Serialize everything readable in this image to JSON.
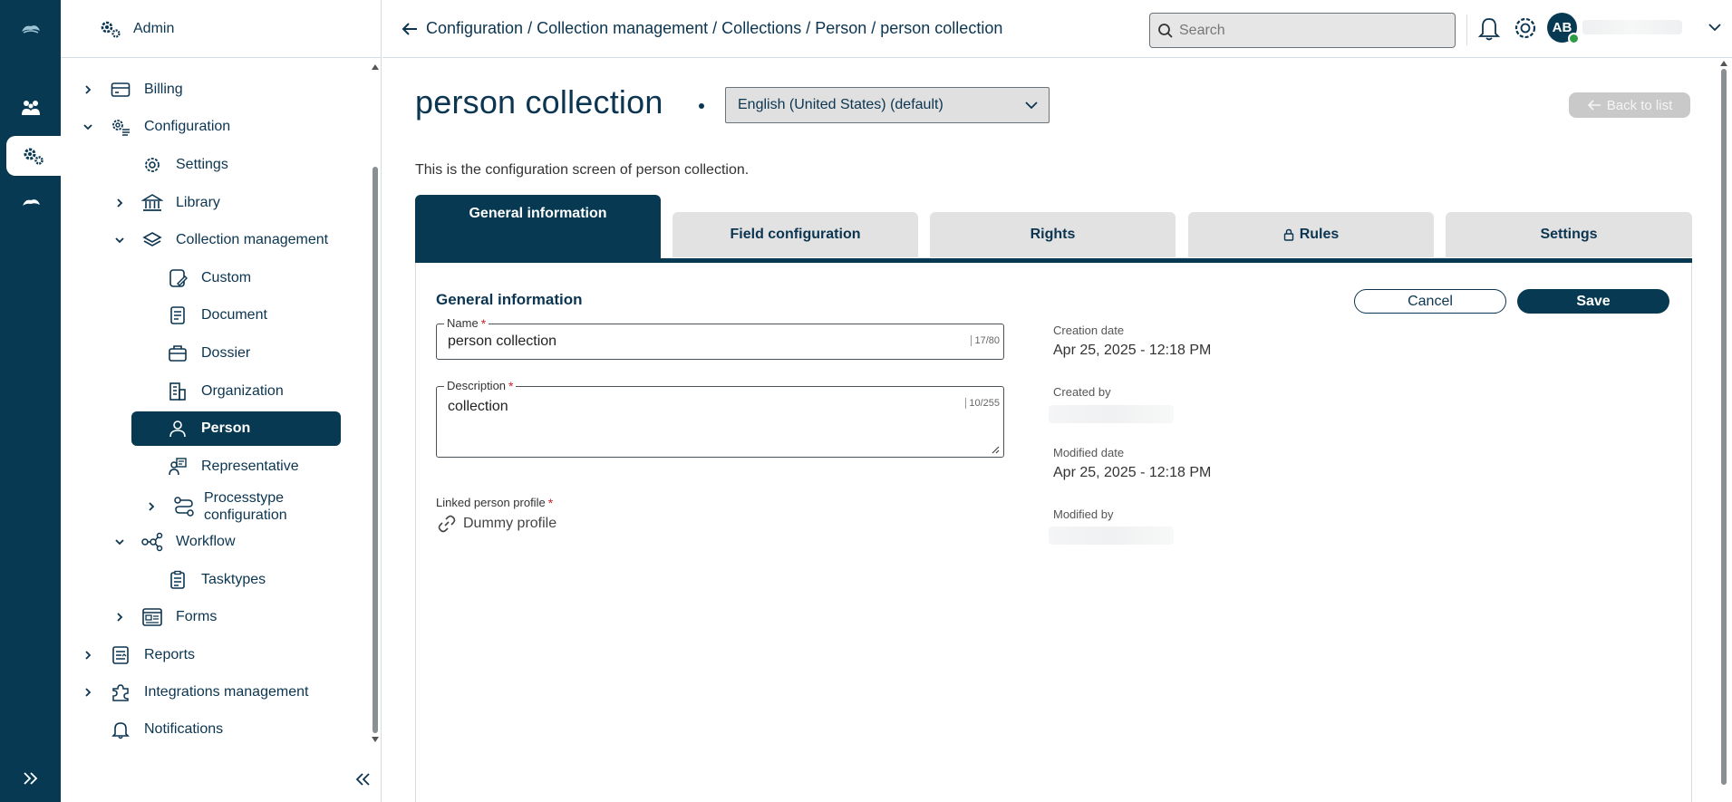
{
  "sidebar": {
    "header": "Admin",
    "items": [
      {
        "label": "Billing",
        "chev": "right",
        "icon": "card-icon"
      },
      {
        "label": "Configuration",
        "chev": "down",
        "icon": "config-gear-icon"
      },
      {
        "label": "Settings",
        "icon": "gear-icon"
      },
      {
        "label": "Library",
        "chev": "right",
        "icon": "library-icon"
      },
      {
        "label": "Collection management",
        "chev": "down",
        "icon": "layers-icon"
      },
      {
        "label": "Custom",
        "icon": "custom-icon"
      },
      {
        "label": "Document",
        "icon": "document-icon"
      },
      {
        "label": "Dossier",
        "icon": "dossier-icon"
      },
      {
        "label": "Organization",
        "icon": "organization-icon"
      },
      {
        "label": "Person",
        "icon": "person-icon",
        "active": true
      },
      {
        "label": "Representative",
        "icon": "representative-icon"
      },
      {
        "label": "Processtype",
        "label2": "configuration",
        "chev": "right",
        "icon": "process-icon"
      },
      {
        "label": "Workflow",
        "chev": "down",
        "icon": "workflow-icon"
      },
      {
        "label": "Tasktypes",
        "icon": "tasktypes-icon"
      },
      {
        "label": "Forms",
        "chev": "right",
        "icon": "forms-icon"
      },
      {
        "label": "Reports",
        "chev": "right",
        "icon": "reports-icon"
      },
      {
        "label": "Integrations management",
        "chev": "right",
        "icon": "puzzle-icon"
      },
      {
        "label": "Notifications",
        "icon": "bell-icon"
      }
    ]
  },
  "header": {
    "breadcrumb": "Configuration / Collection management / Collections / Person / person collection",
    "search_placeholder": "Search",
    "avatar_initials": "AB"
  },
  "main": {
    "title": "person collection",
    "language": "English (United States) (default)",
    "back_to_list": "Back to list",
    "subtitle": "This is the configuration screen of person collection.",
    "tabs": [
      {
        "label": "General information",
        "active": true
      },
      {
        "label": "Field configuration"
      },
      {
        "label": "Rights"
      },
      {
        "label": "Rules",
        "locked": true
      },
      {
        "label": "Settings"
      }
    ],
    "section_title": "General information",
    "cancel_label": "Cancel",
    "save_label": "Save",
    "name_label": "Name",
    "name_value": "person collection",
    "name_count": "17/80",
    "description_label": "Description",
    "description_value": "collection",
    "description_count": "10/255",
    "linked_profile_label": "Linked person profile",
    "linked_profile_value": "Dummy profile",
    "creation_date_label": "Creation date",
    "creation_date_value": "Apr 25, 2025 - 12:18 PM",
    "created_by_label": "Created by",
    "modified_date_label": "Modified date",
    "modified_date_value": "Apr 25, 2025 - 12:18 PM",
    "modified_by_label": "Modified by"
  },
  "colors": {
    "primary": "#073a52",
    "tab_inactive": "#e2e2e2",
    "required": "#d0202a",
    "online": "#2d9c44"
  }
}
